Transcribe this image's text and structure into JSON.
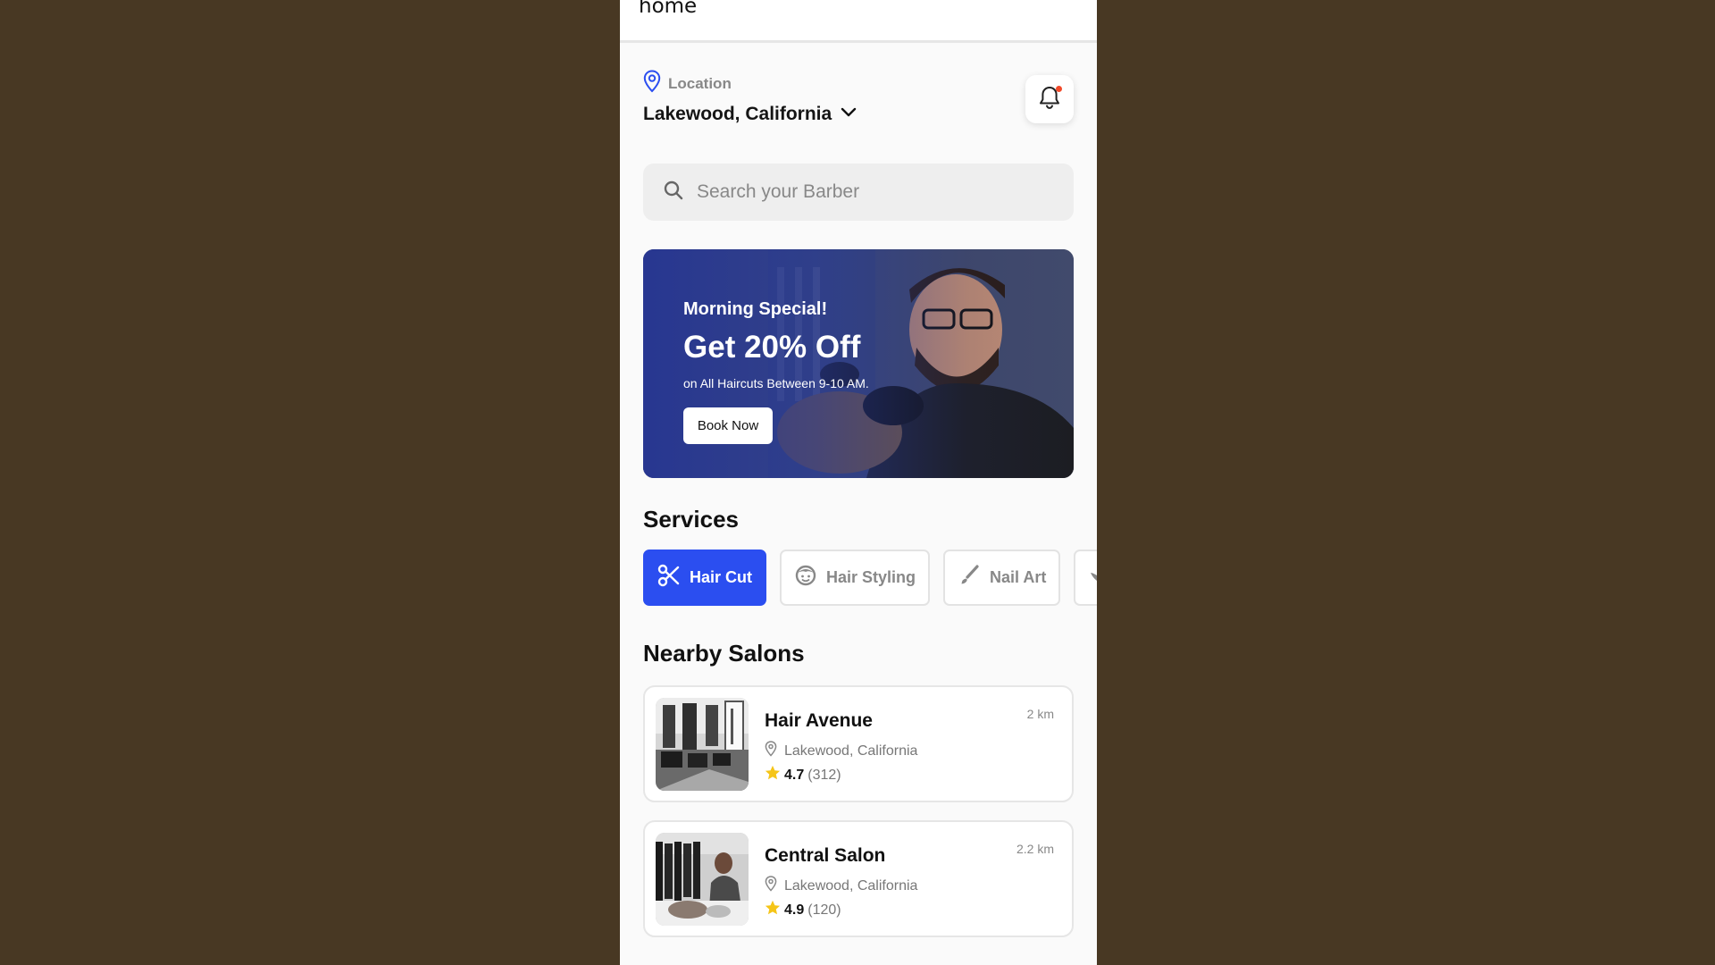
{
  "topbar": {
    "title": "home"
  },
  "location": {
    "label": "Location",
    "value": "Lakewood, California"
  },
  "search": {
    "placeholder": "Search your Barber"
  },
  "banner": {
    "kicker": "Morning Special!",
    "title": "Get 20% Off",
    "subtitle": "on All Haircuts Between 9-10 AM.",
    "button_label": "Book Now"
  },
  "services": {
    "title": "Services",
    "items": [
      {
        "label": "Hair Cut",
        "icon": "scissors-icon",
        "active": true
      },
      {
        "label": "Hair Styling",
        "icon": "face-icon",
        "active": false
      },
      {
        "label": "Nail Art",
        "icon": "brush-icon",
        "active": false
      },
      {
        "label": "",
        "icon": "lotus-icon",
        "active": false
      }
    ]
  },
  "nearby": {
    "title": "Nearby Salons",
    "salons": [
      {
        "name": "Hair Avenue",
        "address": "Lakewood, California",
        "rating": "4.7",
        "reviews": "(312)",
        "distance": "2 km"
      },
      {
        "name": "Central Salon",
        "address": "Lakewood, California",
        "rating": "4.9",
        "reviews": "(120)",
        "distance": "2.2 km"
      }
    ]
  },
  "colors": {
    "accent": "#2b4ef0",
    "background": "#483823",
    "notification_dot": "#f24a2a",
    "star": "#f5c518"
  }
}
